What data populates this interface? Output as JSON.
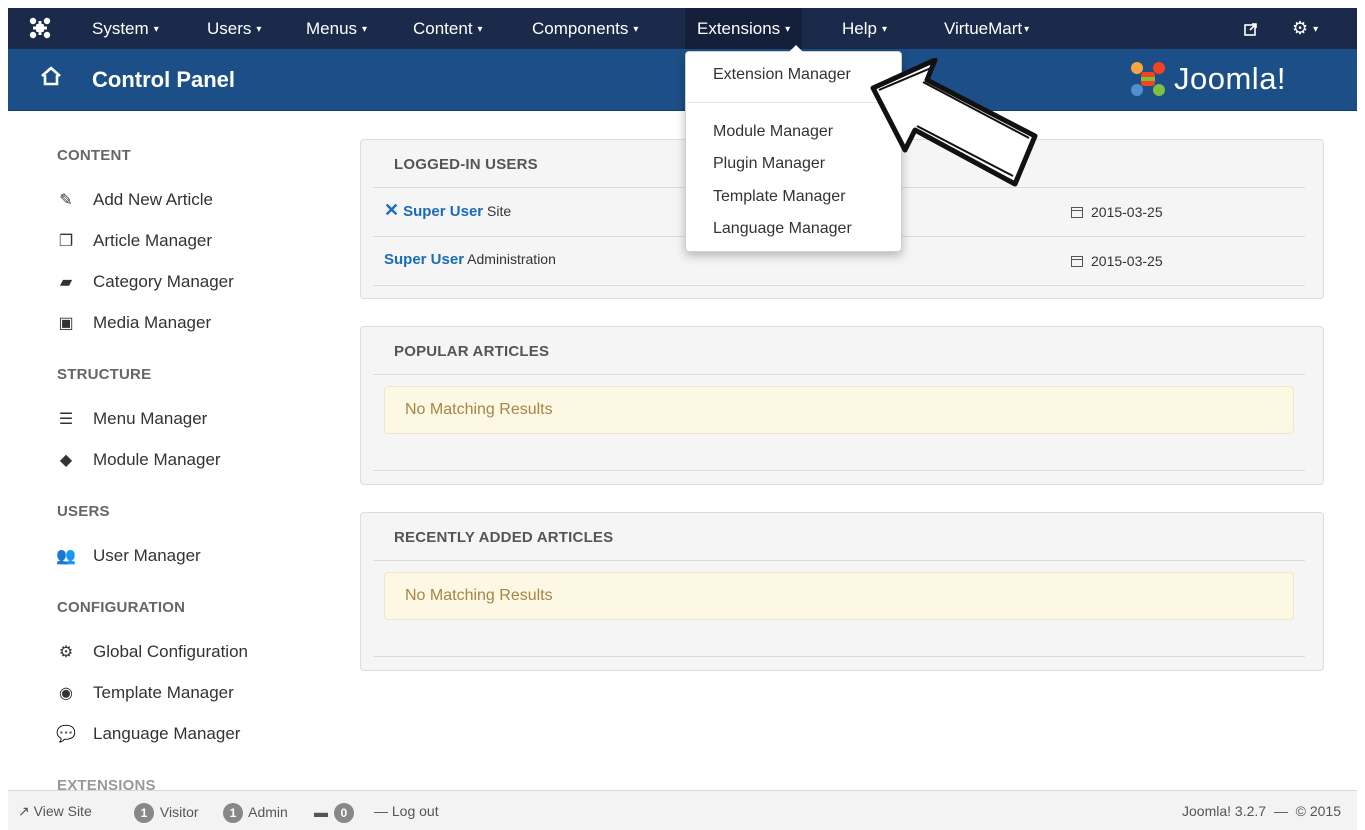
{
  "navbar": {
    "items": [
      {
        "label": "System"
      },
      {
        "label": "Users"
      },
      {
        "label": "Menus"
      },
      {
        "label": "Content"
      },
      {
        "label": "Components"
      },
      {
        "label": "Extensions"
      },
      {
        "label": "Help"
      },
      {
        "label": "VirtueMart"
      }
    ],
    "active_item": "Extensions",
    "caret": "▾"
  },
  "header": {
    "title": "Control Panel",
    "brand": "Joomla!"
  },
  "sidebar": {
    "sections": [
      {
        "heading": "CONTENT",
        "items": [
          "Add New Article",
          "Article Manager",
          "Category Manager",
          "Media Manager"
        ]
      },
      {
        "heading": "STRUCTURE",
        "items": [
          "Menu Manager",
          "Module Manager"
        ]
      },
      {
        "heading": "USERS",
        "items": [
          "User Manager"
        ]
      },
      {
        "heading": "CONFIGURATION",
        "items": [
          "Global Configuration",
          "Template Manager",
          "Language Manager"
        ]
      },
      {
        "heading": "EXTENSIONS",
        "items": []
      }
    ]
  },
  "panels": {
    "logged_in": {
      "title": "LOGGED-IN USERS",
      "rows": [
        {
          "user": "Super User",
          "client": "Site",
          "date": "2015-03-25"
        },
        {
          "user": "Super User",
          "client": "Administration",
          "date": "2015-03-25"
        }
      ]
    },
    "popular": {
      "title": "POPULAR ARTICLES",
      "message": "No Matching Results"
    },
    "recent": {
      "title": "RECENTLY ADDED ARTICLES",
      "message": "No Matching Results"
    }
  },
  "dropdown": {
    "items": [
      "Extension Manager",
      "Module Manager",
      "Plugin Manager",
      "Template Manager",
      "Language Manager"
    ]
  },
  "footer": {
    "view_site": "View Site",
    "visitor_count": "1",
    "visitor_label": "Visitor",
    "admin_count": "1",
    "admin_label": "Admin",
    "messages_count": "0",
    "logout": "Log out",
    "version": "Joomla! 3.2.7",
    "copyright": "© 2015"
  },
  "colors": {
    "navbar": "#1b2a4a",
    "header": "#1c4f87",
    "link": "#1a6bb8",
    "alert_bg": "#fcf8e3"
  }
}
